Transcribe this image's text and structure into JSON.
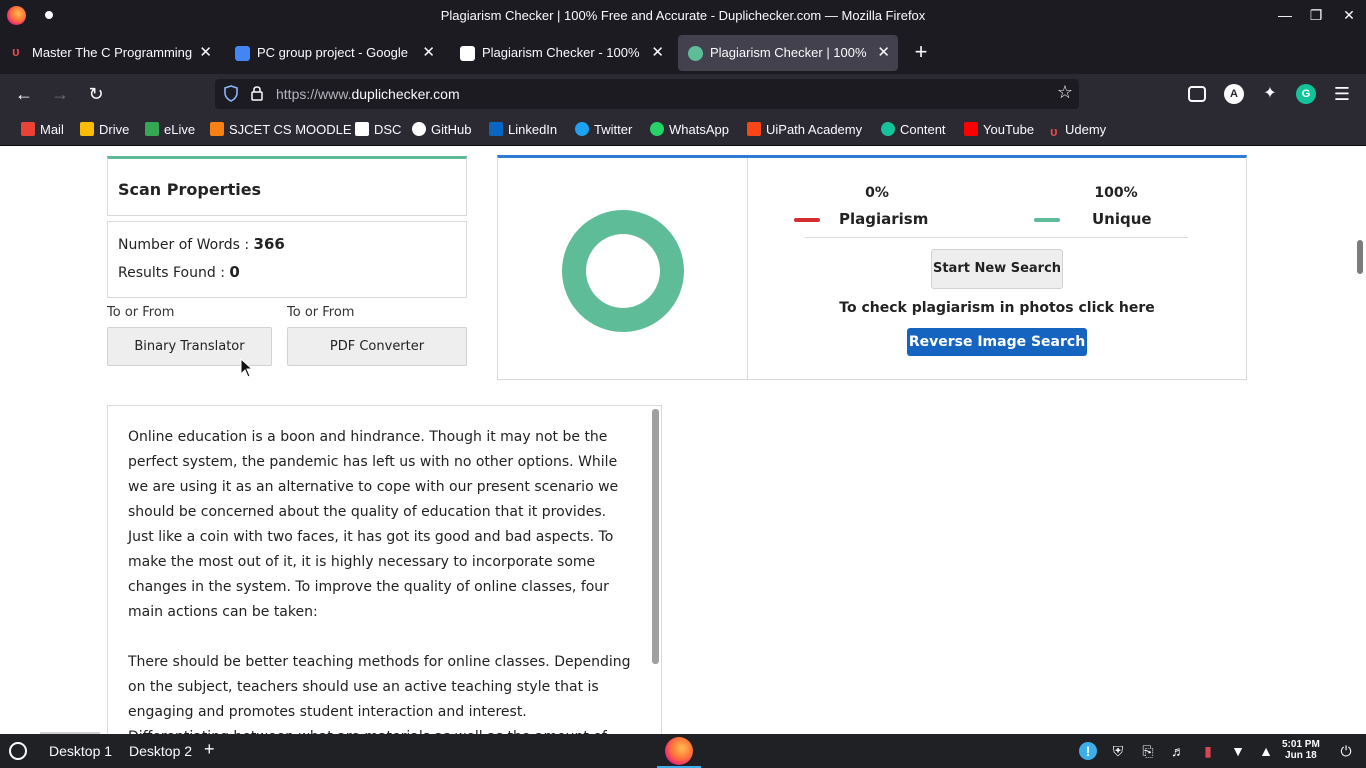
{
  "window": {
    "title": "Plagiarism Checker | 100% Free and Accurate - Duplichecker.com — Mozilla Firefox"
  },
  "tabs": [
    {
      "label": "Master The C Programming",
      "icon": "udemy-icon",
      "color": "#a435f0"
    },
    {
      "label": "PC group project - Google",
      "icon": "google-docs-icon",
      "color": "#4285f4"
    },
    {
      "label": "Plagiarism Checker - 100%",
      "icon": "sst-icon",
      "color": "#ffffff"
    },
    {
      "label": "Plagiarism Checker | 100%",
      "icon": "duplichecker-icon",
      "color": "#5ebd98"
    }
  ],
  "navbar": {
    "url_prefix": "https://www.",
    "url_domain": "duplichecker.com"
  },
  "bookmarks": [
    {
      "label": "Mail",
      "icon": "gmail-icon",
      "color": "#ea4335"
    },
    {
      "label": "Drive",
      "icon": "drive-icon",
      "color": "#fbbc04"
    },
    {
      "label": "eLive",
      "icon": "elive-icon",
      "color": "#34a853"
    },
    {
      "label": "SJCET CS MOODLE",
      "icon": "moodle-icon",
      "color": "#f98012"
    },
    {
      "label": "DSC",
      "icon": "dsc-icon",
      "color": "#ffffff"
    },
    {
      "label": "GitHub",
      "icon": "github-icon",
      "color": "#ffffff"
    },
    {
      "label": "LinkedIn",
      "icon": "linkedin-icon",
      "color": "#0a66c2"
    },
    {
      "label": "Twitter",
      "icon": "twitter-icon",
      "color": "#1da1f2"
    },
    {
      "label": "WhatsApp",
      "icon": "whatsapp-icon",
      "color": "#25d366"
    },
    {
      "label": "UiPath Academy",
      "icon": "uipath-icon",
      "color": "#fa4616"
    },
    {
      "label": "Content",
      "icon": "grammarly-icon",
      "color": "#15c39a"
    },
    {
      "label": "YouTube",
      "icon": "youtube-icon",
      "color": "#ff0000"
    },
    {
      "label": "Udemy",
      "icon": "udemy-icon",
      "color": "#a435f0"
    }
  ],
  "scan": {
    "heading": "Scan Properties",
    "words_label": "Number of Words : ",
    "words_value": "366",
    "results_label": "Results Found : ",
    "results_value": "0",
    "to_from_1": "To or From",
    "to_from_2": "To or From",
    "binary_button": "Binary Translator",
    "pdf_button": "PDF Converter"
  },
  "result": {
    "plagiarism_pct": "0%",
    "plagiarism_label": "Plagiarism",
    "unique_pct": "100%",
    "unique_label": "Unique",
    "start_button": "Start New Search",
    "photos_text": "To check plagiarism in photos click here",
    "reverse_button": "Reverse Image Search",
    "plagiarism_color": "#d32f2f",
    "unique_color": "#5ebd98",
    "plagiarism_fraction": 0,
    "unique_fraction": 1
  },
  "text": {
    "para1_lines": [
      "Online education is a boon and hindrance. Though it may not be the",
      "perfect system, the pandemic has left us with no other options. While",
      "we are using it as an alternative to cope with our present scenario we",
      "should be concerned about the quality of education that it provides.",
      "Just like a coin with two faces, it has got its good and bad aspects. To",
      "make the most out of it, it is highly necessary to incorporate some",
      "changes in the system. To improve the quality of online classes, four",
      "main actions can be taken:"
    ],
    "para2_lines": [
      "There should be better teaching methods for online classes. Depending",
      "on the subject, teachers should use an active teaching style that is",
      "engaging and promotes student interaction and interest.",
      "Differentiating between what are materials as well as the amount of"
    ]
  },
  "taskbar": {
    "desktop1": "Desktop 1",
    "desktop2": "Desktop 2",
    "time": "5:01 PM",
    "date": "Jun 18"
  }
}
